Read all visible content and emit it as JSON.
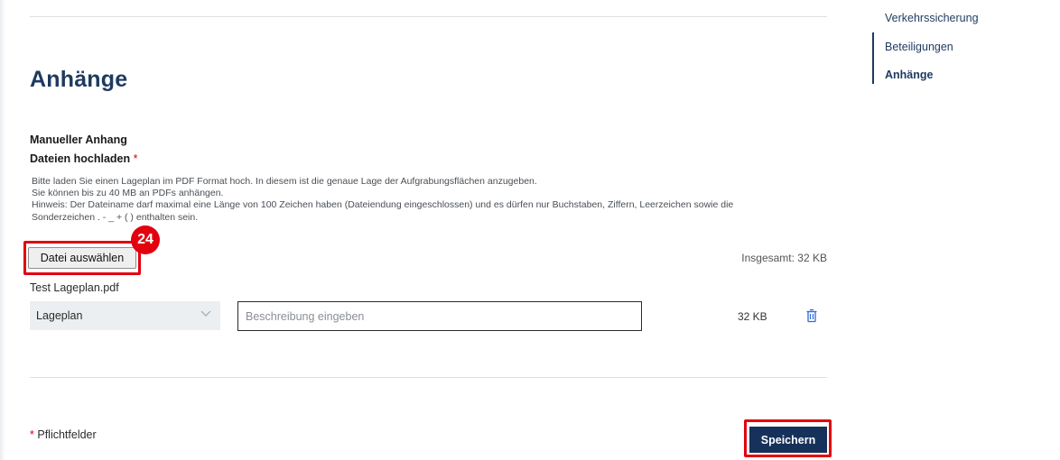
{
  "section": {
    "title": "Anhänge",
    "manual_label": "Manueller Anhang",
    "upload_label": "Dateien hochladen",
    "required_marker": "*",
    "help_line1": "Bitte laden Sie einen Lageplan im PDF Format hoch. In diesem ist die genaue Lage der Aufgrabungsflächen anzugeben.",
    "help_line2": "Sie können bis zu 40 MB an PDFs anhängen.",
    "help_line3": "Hinweis: Der Dateiname darf maximal eine Länge von 100 Zeichen haben (Dateiendung eingeschlossen) und es dürfen nur Buchstaben, Ziffern, Leerzeichen sowie die",
    "help_line4": "Sonderzeichen . - _ + ( ) enthalten sein.",
    "choose_file_label": "Datei auswählen",
    "total_label": "Insgesamt: 32 KB"
  },
  "file": {
    "name": "Test Lageplan.pdf",
    "type_selected": "Lageplan",
    "description_placeholder": "Beschreibung eingeben",
    "size": "32 KB"
  },
  "footer": {
    "required_marker": "*",
    "required_note": "Pflichtfelder",
    "save_label": "Speichern"
  },
  "annotation": {
    "step_number": "24",
    "highlight_color": "#e3000f"
  },
  "side_nav": {
    "items": [
      {
        "label": "Verkehrssicherung"
      },
      {
        "label": "Beteiligungen"
      },
      {
        "label": "Anhänge"
      }
    ]
  },
  "colors": {
    "brand_dark_blue": "#16315a",
    "heading_blue": "#1e3a5f",
    "required_red": "#d0021b"
  },
  "icons": {
    "select_chevron": "chevron-down-icon",
    "delete": "trash-icon"
  }
}
